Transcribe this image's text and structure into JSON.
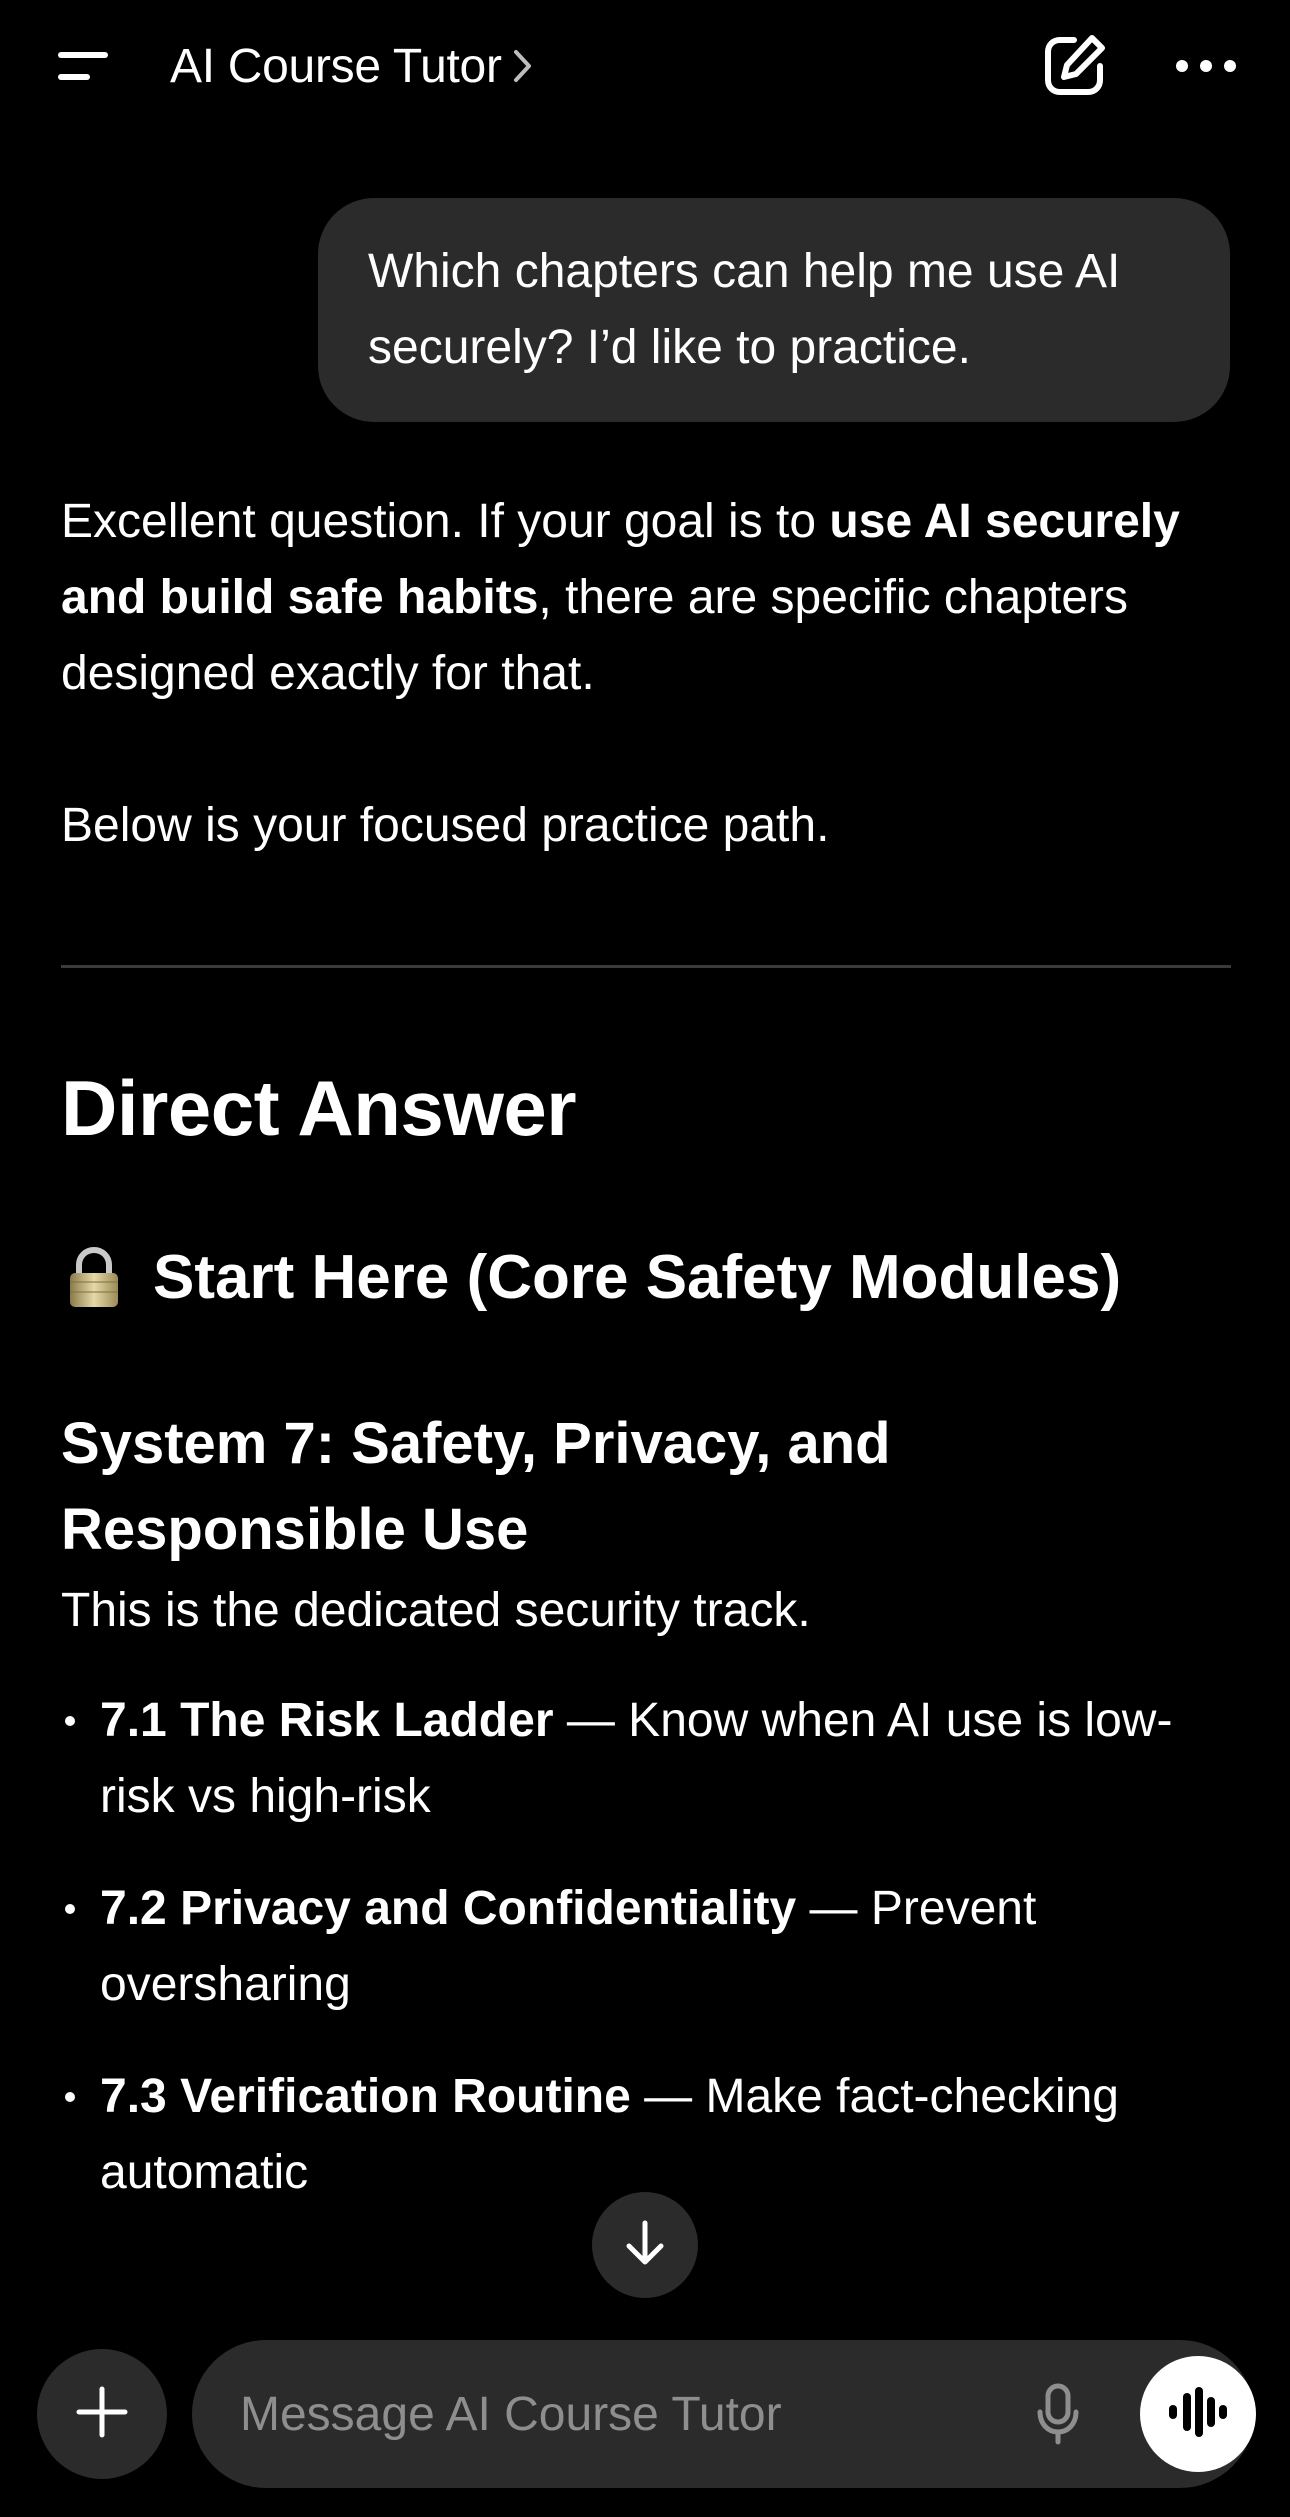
{
  "header": {
    "title": "AI Course Tutor",
    "icons": {
      "menu": "menu-icon",
      "chevron": "chevron-right-icon",
      "new_chat": "edit-icon",
      "more": "ellipsis-icon"
    }
  },
  "user_message": {
    "text": "Which chapters can help me use AI securely? I’d like to practice."
  },
  "assistant_message": {
    "intro_before": "Excellent question. If your goal is to ",
    "intro_bold": "use AI securely and build safe habits",
    "intro_after": ", there are specific chapters designed exactly for that.",
    "path_line": "Below is your focused practice path.",
    "heading_direct": "Direct Answer",
    "heading_start_emoji_icon": "lock-icon",
    "heading_start": "Start Here (Core Safety Modules)",
    "heading_system": "System 7: Safety, Privacy, and Responsible Use",
    "track_line": "This is the dedicated security track.",
    "modules": [
      {
        "title": "7.1 The Risk Ladder",
        "desc": " — Know when AI use is low-risk vs high-risk"
      },
      {
        "title": "7.2 Privacy and Confidentiality",
        "desc": " — Prevent oversharing"
      },
      {
        "title": "7.3 Verification Routine",
        "desc": " — Make fact-checking automatic"
      }
    ]
  },
  "composer": {
    "placeholder": "Message AI Course Tutor",
    "icons": {
      "attach": "plus-icon",
      "mic": "mic-icon",
      "voice": "voice-waveform-icon",
      "scroll": "arrow-down-icon"
    }
  },
  "colors": {
    "background": "#000000",
    "surface": "#2b2b2b",
    "text": "#ffffff",
    "placeholder": "#8e8e8e",
    "divider": "#3a3a3a"
  }
}
